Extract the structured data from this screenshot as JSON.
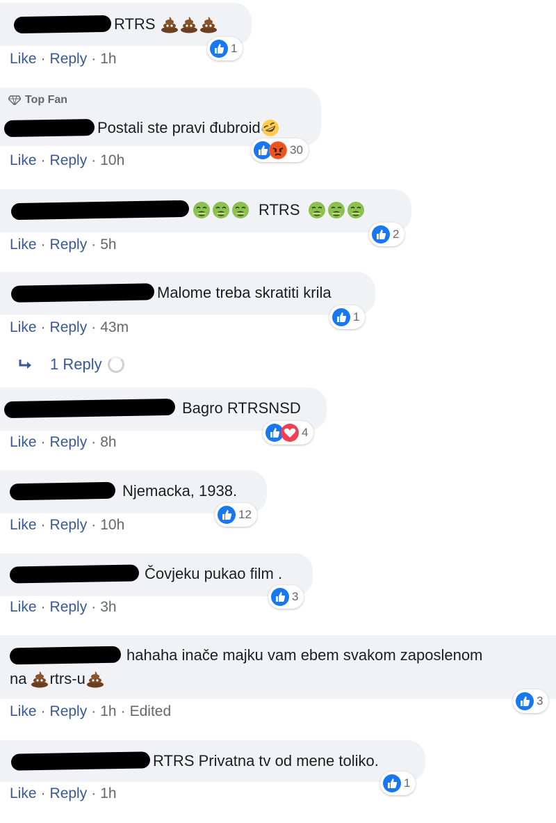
{
  "comments": [
    {
      "text": "RTRS",
      "suffix_emoji": [
        "pile-of-poo",
        "pile-of-poo",
        "pile-of-poo"
      ],
      "reactions": [
        "like"
      ],
      "count": "1",
      "like": "Like",
      "reply": "Reply",
      "time": "1h"
    },
    {
      "badge": "Top Fan",
      "text": "Postali ste pravi đubroid",
      "suffix_emoji": [
        "rolling-laughing"
      ],
      "reactions": [
        "like",
        "angry"
      ],
      "count": "30",
      "like": "Like",
      "reply": "Reply",
      "time": "10h"
    },
    {
      "prefix_emoji": [
        "nauseated",
        "nauseated",
        "nauseated"
      ],
      "text": "RTRS",
      "suffix_emoji": [
        "nauseated",
        "nauseated",
        "nauseated"
      ],
      "reactions": [
        "like"
      ],
      "count": "2",
      "like": "Like",
      "reply": "Reply",
      "time": "5h"
    },
    {
      "text": "Malome treba skratiti krila",
      "reactions": [
        "like"
      ],
      "count": "1",
      "like": "Like",
      "reply": "Reply",
      "time": "43m",
      "replies_label": "1 Reply"
    },
    {
      "text": "Bagro RTRSNSD",
      "reactions": [
        "like",
        "love"
      ],
      "count": "4",
      "like": "Like",
      "reply": "Reply",
      "time": "8h"
    },
    {
      "text": "Njemacka, 1938.",
      "reactions": [
        "like"
      ],
      "count": "12",
      "like": "Like",
      "reply": "Reply",
      "time": "10h"
    },
    {
      "text": "Čovjeku pukao film .",
      "reactions": [
        "like"
      ],
      "count": "3",
      "like": "Like",
      "reply": "Reply",
      "time": "3h"
    },
    {
      "text": "hahaha inače majku vam ebem svakom zaposlenom",
      "text2_pre": "na",
      "text2": "rtrs-u",
      "reactions": [
        "like"
      ],
      "count": "3",
      "like": "Like",
      "reply": "Reply",
      "time": "1h",
      "edited": "Edited"
    },
    {
      "text": "RTRS Privatna tv od mene toliko.",
      "reactions": [
        "like"
      ],
      "count": "1",
      "like": "Like",
      "reply": "Reply",
      "time": "1h"
    }
  ],
  "colors": {
    "link": "#385898",
    "meta": "#65676b",
    "bubble": "#f0f2f5",
    "like": "#1877f2",
    "love": "#f33e58",
    "angry": "#f7714c"
  }
}
